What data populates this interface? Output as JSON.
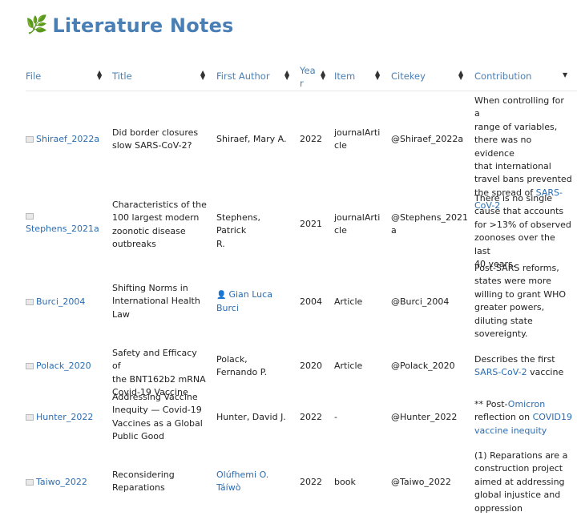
{
  "page": {
    "icon": "herb-leaf-icon",
    "title": "Literature Notes"
  },
  "columns": {
    "file": "File",
    "title": "Title",
    "author": "First Author",
    "year_1": "Yea",
    "year_2": "r",
    "item": "Item",
    "citekey": "Citekey",
    "contribution": "Contribution"
  },
  "rows": [
    {
      "file": "Shiraef_2022a",
      "title": [
        "Did border closures",
        "slow SARS-CoV-2?"
      ],
      "author": [
        "Shiraef, Mary A."
      ],
      "year": "2022",
      "item": [
        "journalArti",
        "cle"
      ],
      "citekey": [
        "@Shiraef_2022a"
      ],
      "contribution": [
        "When controlling for a",
        "range of variables,",
        "there was no evidence",
        "that international",
        "travel bans prevented",
        "the spread of ",
        "SARS-",
        "CoV-2"
      ]
    },
    {
      "file": "Stephens_2021a",
      "title": [
        "Characteristics of the",
        "100 largest modern",
        "zoonotic disease",
        "outbreaks"
      ],
      "author": [
        "Stephens, Patrick",
        "R."
      ],
      "year": "2021",
      "item": [
        "journalArti",
        "cle"
      ],
      "citekey": [
        "@Stephens_2021",
        "a"
      ],
      "contribution": [
        "There is no single",
        "cause that accounts",
        "for >13% of observed",
        "zoonoses over the last",
        "40 years."
      ]
    },
    {
      "file": "Burci_2004",
      "title": [
        "Shifting Norms in",
        "International Health",
        "Law"
      ],
      "author": [
        "Gian Luca",
        "Burci"
      ],
      "year": "2004",
      "item": [
        "Article"
      ],
      "citekey": [
        "@Burci_2004"
      ],
      "contribution": [
        "Post-SARS reforms,",
        "states were more",
        "willing to grant WHO",
        "greater powers,",
        "diluting state",
        "sovereignty."
      ]
    },
    {
      "file": "Polack_2020",
      "title": [
        "Safety and Efficacy of",
        "the BNT162b2 mRNA",
        "Covid-19 Vaccine"
      ],
      "author": [
        "Polack,",
        "Fernando P."
      ],
      "year": "2020",
      "item": [
        "Article"
      ],
      "citekey": [
        "@Polack_2020"
      ],
      "contribution": [
        "Describes the first",
        "SARS-CoV-2",
        " vaccine"
      ]
    },
    {
      "file": "Hunter_2022",
      "title": [
        "Addressing Vaccine",
        "Inequity — Covid-19",
        "Vaccines as a Global",
        "Public Good"
      ],
      "author": [
        "Hunter, David J."
      ],
      "year": "2022",
      "item": [
        "-"
      ],
      "citekey": [
        "@Hunter_2022"
      ],
      "contribution": [
        "** Post-",
        "Omicron",
        "reflection on ",
        "COVID19",
        "vaccine inequity"
      ]
    },
    {
      "file": "Taiwo_2022",
      "title": [
        "Reconsidering",
        "Reparations"
      ],
      "author": [
        "Olúfhemi O.",
        "Táíwò"
      ],
      "year": "2022",
      "item": [
        "book"
      ],
      "citekey": [
        "@Taiwo_2022"
      ],
      "contribution": [
        "(1) Reparations are a",
        "construction project",
        "aimed at addressing",
        "global injustice and",
        "oppression"
      ]
    }
  ],
  "colors": {
    "accent": "#4a7fb5",
    "link": "#2b6cb0"
  }
}
